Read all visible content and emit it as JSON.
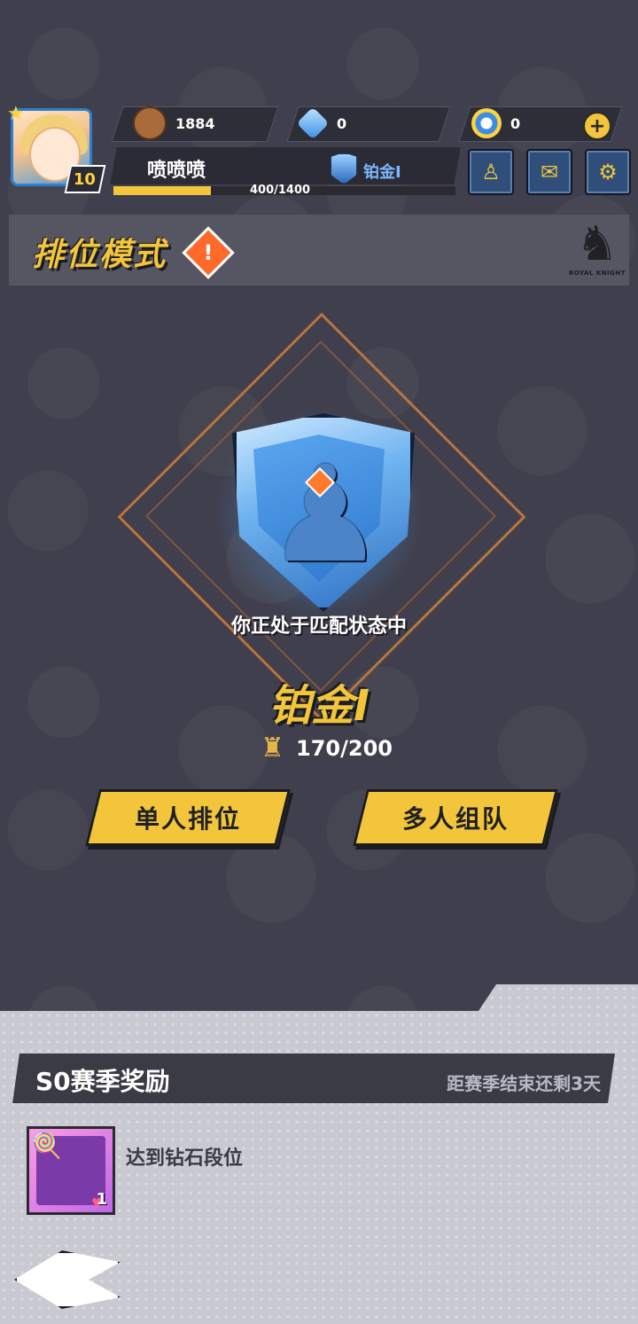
{
  "header": {
    "player": {
      "level": "10",
      "name": "喷喷喷"
    },
    "resources": [
      {
        "icon": "potato-coin-icon",
        "value": "1884"
      },
      {
        "icon": "diamond-icon",
        "value": "0"
      },
      {
        "icon": "ring-token-icon",
        "value": "0"
      }
    ],
    "rank_label": "铂金I",
    "xp": {
      "current": 400,
      "max": 1400,
      "text": "400/1400"
    }
  },
  "mode": {
    "title": "排位模式",
    "logo_caption": "ROYAL KNIGHT"
  },
  "match": {
    "status_text": "你正处于匹配状态中",
    "rank_name": "铂金I",
    "trophy_value": "170/200"
  },
  "actions": {
    "solo_label": "单人排位",
    "team_label": "多人组队"
  },
  "season": {
    "title": "S0赛季奖励",
    "remaining": "距赛季结束还剩3天",
    "reward": {
      "count": "1",
      "description": "达到钻石段位"
    }
  },
  "colors": {
    "accent": "#f2c53a",
    "background": "#3f3f4d",
    "rank_blue": "#7bb6ff"
  }
}
